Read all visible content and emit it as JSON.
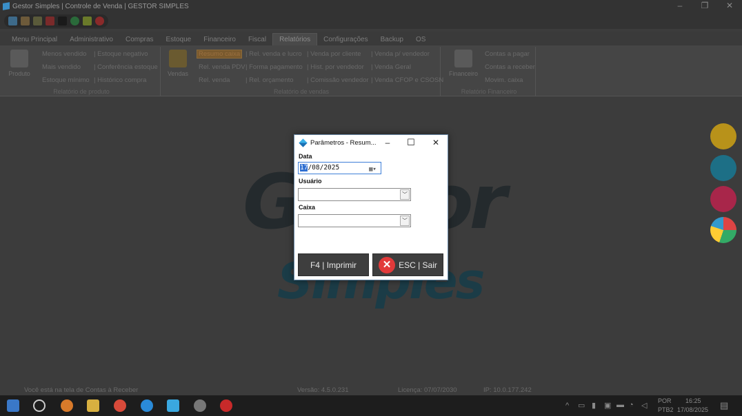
{
  "window": {
    "title": "Gestor Simples | Controle de Venda | GESTOR SIMPLES",
    "controls": [
      "–",
      "❐",
      "✕"
    ]
  },
  "menu": {
    "tabs": [
      "Menu Principal",
      "Administrativo",
      "Compras",
      "Estoque",
      "Financeiro",
      "Fiscal",
      "Relatórios",
      "Configurações",
      "Backup",
      "OS"
    ],
    "active": "Relatórios"
  },
  "ribbon": {
    "produto": {
      "big_label": "Produto",
      "items": [
        "Menos vendido",
        "Mais vendido",
        "Estoque mínimo",
        "| Estoque negativo",
        "| Conferência estoque",
        "| Histórico compra"
      ],
      "group_label": "Relatório de produto"
    },
    "vendas": {
      "big_label": "Vendas",
      "items": [
        "Resumo caixa",
        "Rel. venda PDV",
        "Rel. venda",
        "| Rel. venda e lucro",
        "| Forma pagamento",
        "| Rel. orçamento",
        "| Venda por cliente",
        "| Hist. por vendedor",
        "| Comissão vendedor",
        "| Venda p/ vendedor",
        "| Venda Geral",
        "| Venda CFOP e CSOSN"
      ],
      "group_label": "Relatório de vendas"
    },
    "financeiro": {
      "big_label": "Financeiro",
      "items": [
        "Contas a pagar",
        "Contas a receber",
        "Movim. caixa"
      ],
      "group_label": "Relatório Financeiro"
    }
  },
  "background_logo": {
    "line1": "Gestor",
    "line2": "Simples"
  },
  "dialog": {
    "title": "Parâmetros - Resum...",
    "data_label": "Data",
    "date_day": "17",
    "date_rest": "/08/2025",
    "usuario_label": "Usuário",
    "caixa_label": "Caixa",
    "print_button": "F4 | Imprimir",
    "exit_button": "ESC | Sair"
  },
  "status": {
    "message": "Você está na tela de Contas à Receber",
    "version": "Versão: 4.5.0.231",
    "license": "Licença: 07/07/2030",
    "ip": "IP: 10.0.177.242"
  },
  "tray": {
    "lang1": "POR",
    "lang2": "PTB2",
    "time": "16:25",
    "date": "17/08/2025"
  },
  "colors": {
    "accent_blue": "#2f6fd1",
    "exit_red": "#e23a3a",
    "side_yellow": "#b8921a",
    "side_teal": "#1d6f86",
    "side_pink": "#a8264a"
  }
}
